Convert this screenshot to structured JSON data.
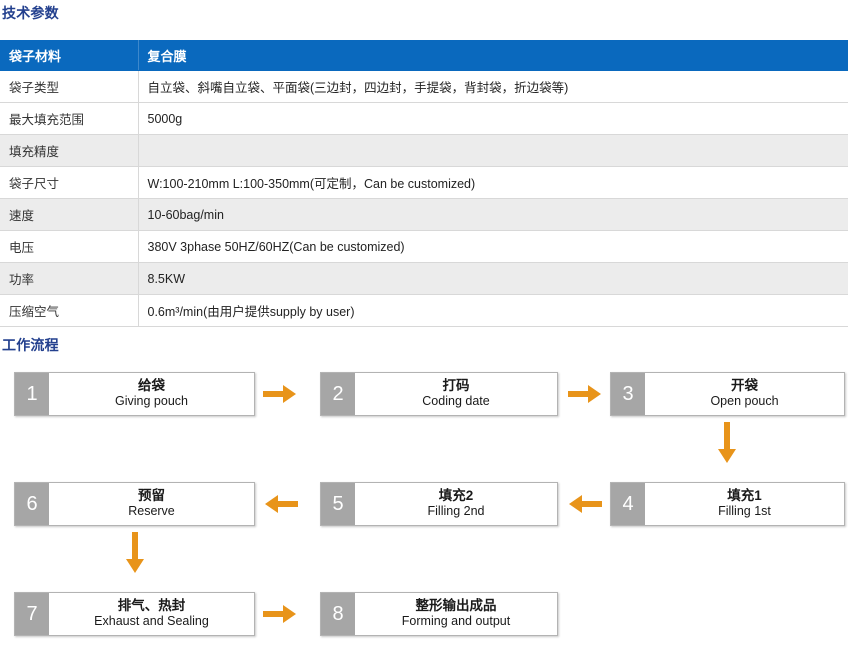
{
  "sections": {
    "tech": {
      "title": "技术参数"
    },
    "flow": {
      "title": "工作流程"
    }
  },
  "spec_table": {
    "header": {
      "label": "袋子材料",
      "value": "复合膜"
    },
    "rows": [
      {
        "label": "袋子类型",
        "value": "自立袋、斜嘴自立袋、平面袋(三边封，四边封，手提袋，背封袋，折边袋等)"
      },
      {
        "label": "最大填充范围",
        "value": "5000g"
      },
      {
        "label": "填充精度",
        "value": ""
      },
      {
        "label": "袋子尺寸",
        "value": "W:100-210mm L:100-350mm(可定制，Can be customized)"
      },
      {
        "label": "速度",
        "value": "10-60bag/min"
      },
      {
        "label": "电压",
        "value": "380V 3phase 50HZ/60HZ(Can be customized)"
      },
      {
        "label": "功率",
        "value": "8.5KW"
      },
      {
        "label": "压缩空气",
        "value": "0.6m³/min(由用户提供supply by user)"
      }
    ]
  },
  "flow": {
    "steps": [
      {
        "num": "1",
        "cn": "给袋",
        "en": "Giving pouch"
      },
      {
        "num": "2",
        "cn": "打码",
        "en": "Coding date"
      },
      {
        "num": "3",
        "cn": "开袋",
        "en": "Open pouch"
      },
      {
        "num": "4",
        "cn": "填充1",
        "en": "Filling 1st"
      },
      {
        "num": "5",
        "cn": "填充2",
        "en": "Filling 2nd"
      },
      {
        "num": "6",
        "cn": "预留",
        "en": "Reserve"
      },
      {
        "num": "7",
        "cn": "排气、热封",
        "en": "Exhaust and Sealing"
      },
      {
        "num": "8",
        "cn": "整形输出成品",
        "en": "Forming and output"
      }
    ],
    "arrows": [
      {
        "name": "arrow-1-to-2",
        "direction": "right"
      },
      {
        "name": "arrow-2-to-3",
        "direction": "right"
      },
      {
        "name": "arrow-3-to-4",
        "direction": "down"
      },
      {
        "name": "arrow-4-to-5",
        "direction": "left"
      },
      {
        "name": "arrow-5-to-6",
        "direction": "left"
      },
      {
        "name": "arrow-6-to-7",
        "direction": "down"
      },
      {
        "name": "arrow-7-to-8",
        "direction": "right"
      }
    ]
  },
  "colors": {
    "heading": "#23408e",
    "table_header_bg": "#0a69be",
    "row_alt_bg": "#ececec",
    "arrow": "#e8941a",
    "step_number_bg": "#a6a6a6"
  }
}
